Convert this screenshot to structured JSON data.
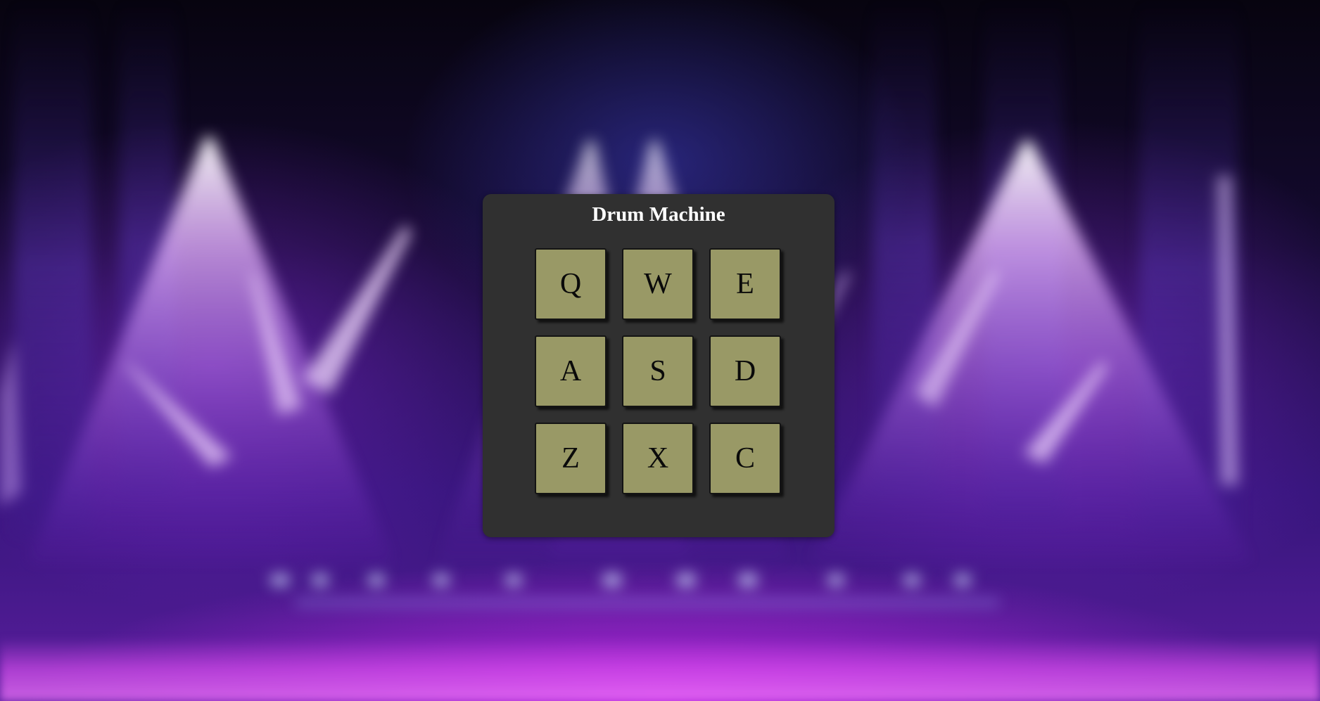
{
  "app": {
    "title": "Drum Machine"
  },
  "colors": {
    "panel": "#303030",
    "pad": "#999966",
    "pad_text": "#0a0a0a",
    "title_text": "#ffffff",
    "background_accent": "#8a2be2"
  },
  "pads": [
    {
      "key": "Q"
    },
    {
      "key": "W"
    },
    {
      "key": "E"
    },
    {
      "key": "A"
    },
    {
      "key": "S"
    },
    {
      "key": "D"
    },
    {
      "key": "Z"
    },
    {
      "key": "X"
    },
    {
      "key": "C"
    }
  ],
  "background": {
    "image": "concert-stage-spotlights"
  }
}
